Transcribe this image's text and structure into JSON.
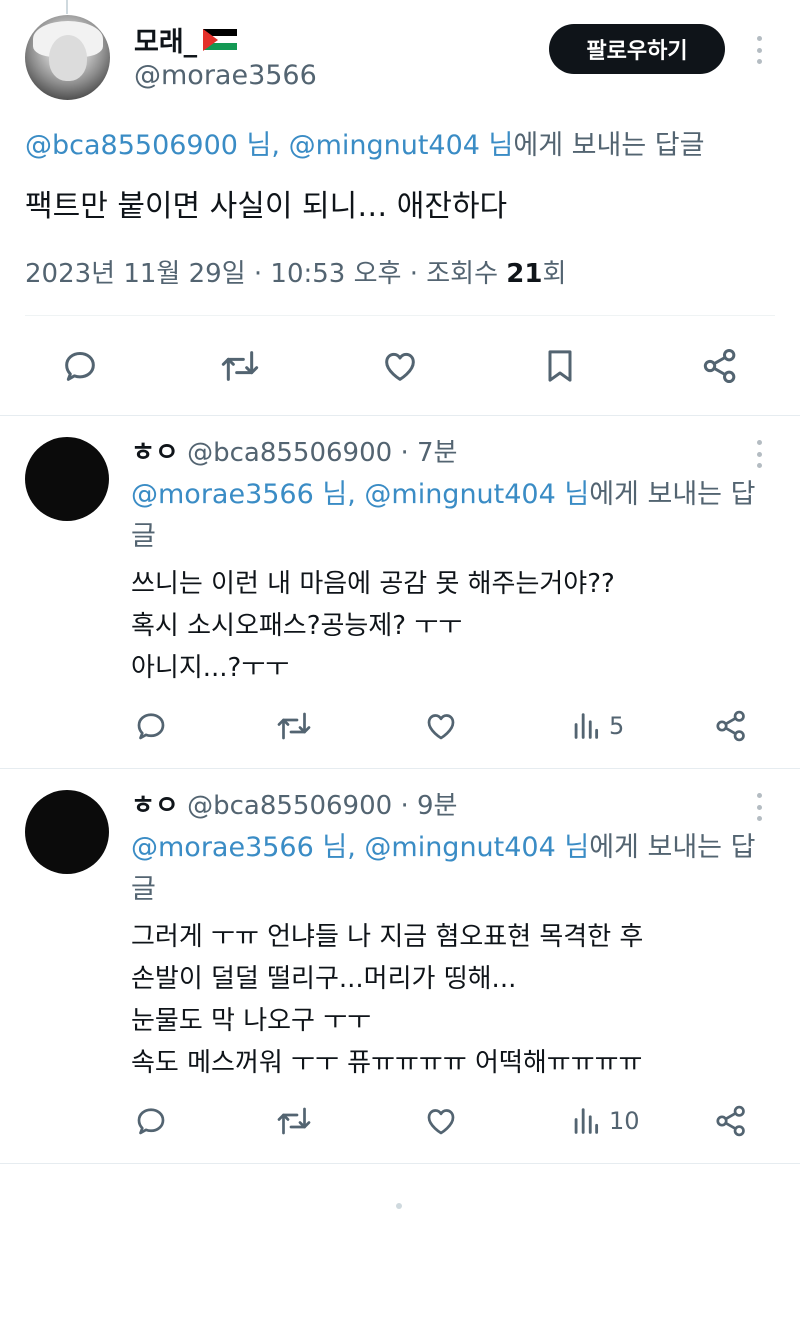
{
  "main_tweet": {
    "display_name": "모래_",
    "handle": "@morae3566",
    "follow_label": "팔로우하기",
    "reply_to": {
      "mention1": "@bca85506900 님",
      "sep": ", ",
      "mention2": "@mingnut404 님",
      "suffix": "에게 보내는 답글"
    },
    "text": "팩트만 붙이면 사실이 되니… 애잔하다",
    "meta_prefix": "2023년 11월 29일 · 10:53 오후 · 조회수 ",
    "views": "21",
    "meta_suffix": "회",
    "icons": [
      "reply-icon",
      "retweet-icon",
      "like-icon",
      "bookmark-icon",
      "share-icon"
    ]
  },
  "replies": [
    {
      "name": "ㅎㅇ",
      "handle": "@bca85506900",
      "time": " · 7분",
      "reply_to": {
        "mention1": "@morae3566 님",
        "sep": ", ",
        "mention2": "@mingnut404 님",
        "suffix": "에게 보내는 답글"
      },
      "lines": [
        "쓰니는 이런 내 마음에 공감 못 해주는거야??",
        "혹시 소시오패스?공능제? ㅜㅜ",
        "아니지...?ㅜㅜ"
      ],
      "views": "5"
    },
    {
      "name": "ㅎㅇ",
      "handle": "@bca85506900",
      "time": " · 9분",
      "reply_to": {
        "mention1": "@morae3566 님",
        "sep": ", ",
        "mention2": "@mingnut404 님",
        "suffix": "에게 보내는 답글"
      },
      "lines": [
        "그러게 ㅜㅠ 언냐들 나 지금 혐오표현 목격한 후",
        "손발이 덜덜 떨리구...머리가 띵해...",
        "눈물도 막 나오구 ㅜㅜ",
        "속도 메스꺼워 ㅜㅜ 퓨ㅠㅠㅠㅠ 어떡해ㅠㅠㅠㅠ"
      ],
      "views": "10"
    }
  ],
  "colors": {
    "mention": "#3a8cc5",
    "muted": "#536471",
    "text": "#0f1419",
    "follow_bg": "#0f1419"
  }
}
